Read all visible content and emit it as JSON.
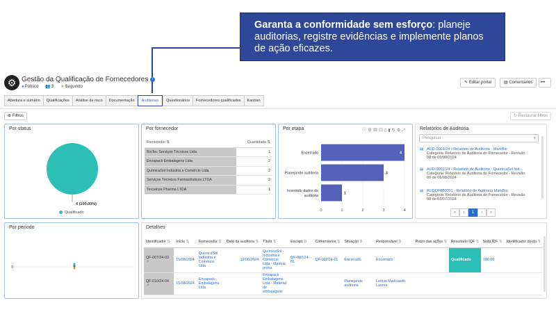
{
  "callout": {
    "bold": "Garanta a conformidade sem esforço",
    "rest": ": planeje auditorias, registre evidências e implemente planos de ação eficazes."
  },
  "header": {
    "title": "Gestão da Qualificação de Fornecedores",
    "visibility": "Público",
    "members": "3",
    "following": "Seguindo"
  },
  "actions": {
    "edit": "Editar portal",
    "comments": "Comentários",
    "more": "•••"
  },
  "tabs": [
    "Abertura e sumário",
    "Qualificações",
    "Análise de risco",
    "Documentação",
    "Auditorias",
    "Questionários",
    "Fornecedores qualificados",
    "Kanban"
  ],
  "filters": {
    "filter_label": "Filtros",
    "restore_label": "Restaurar filtros"
  },
  "status_panel": {
    "title": "Por status",
    "slice_label": "4 (100.00%)",
    "legend": "Qualificado"
  },
  "supplier_panel": {
    "title": "Por fornecedor",
    "col_supplier": "Fornecedor",
    "col_qty": "Quantidade",
    "rows": [
      {
        "name": "BioTec Serviços Técnicos Ltda.",
        "qty": "1"
      },
      {
        "name": "Envapack Embalagens Ltda",
        "qty": "2"
      },
      {
        "name": "QuímicaSol Indústria e Comércio Ltda",
        "qty": "2"
      },
      {
        "name": "Serviços Técnicos Farmacêuticos LTDA",
        "qty": "2"
      },
      {
        "name": "Terceirize Pharma LTDA",
        "qty": "1"
      }
    ]
  },
  "stage_panel": {
    "title": "Por etapa"
  },
  "chart_data": [
    {
      "type": "pie",
      "title": "Por status",
      "categories": [
        "Qualificado"
      ],
      "values": [
        4
      ],
      "labels": [
        "4 (100.00%)"
      ]
    },
    {
      "type": "bar",
      "title": "Por etapa",
      "orientation": "horizontal",
      "categories": [
        "Encerrado",
        "Planejando auditoria",
        "Inserindo dados da auditoria"
      ],
      "values": [
        4,
        3,
        1
      ],
      "data_labels": [
        "4",
        "3",
        "1"
      ],
      "xlim": [
        0,
        4
      ],
      "xticks": [
        "0",
        "1",
        "2",
        "3",
        "4"
      ],
      "color": "#5560b8"
    }
  ],
  "reports_panel": {
    "title": "Relatórios de Auditoria",
    "search_placeholder": "Pesquisar",
    "items": [
      {
        "title": "AUD-0001/24 - Relatório de Auditoria - MarkBio",
        "sub1": "Categoria: Relatório de Auditoria do Fornecedor - Revisão",
        "sub2": "00 de 05/08/2024"
      },
      {
        "title": "AUD-0002/24 - Relatório de Auditoria - QuímicaSol Ind...",
        "sub1": "Categoria: Relatório de Auditoria do Fornecedor - Revisão",
        "sub2": "00 de 06/08/2024"
      },
      {
        "title": "AUDQF000001 - Relatório de Auditoria MarkBio",
        "sub1": "Categoria: Relatório de Auditoria do Fornecedor - Revisão",
        "sub2": "00 de 02/07/2024"
      }
    ],
    "pager": [
      "«",
      "‹",
      "1",
      "›",
      "»"
    ]
  },
  "period_panel": {
    "title": "Por período",
    "axis_zero": "0"
  },
  "details_panel": {
    "title": "Detalhes",
    "columns": [
      "Identificador",
      "Início",
      "Fornecedor",
      "Data da auditoria",
      "Título",
      "Escopo",
      "Comentários",
      "Situação",
      "Responsável",
      "Prazo das ações",
      "Resultado IQF",
      "Nota IQF",
      "Identificador do do"
    ],
    "rows": [
      {
        "id": "QF-007/24-03",
        "inicio": "15/08/2024",
        "fornecedor": "QuímicaSol Indústria e Comércio Ltda",
        "data": "19/08/2024",
        "titulo": "QuímicaSol - Indústria e Comércio Ltda - Matéria prima",
        "escopo": "QF-007/24-01",
        "comentarios": "QF-007/24-01",
        "situacao": "Encerrado",
        "responsavel": "Encerrado",
        "prazo": "",
        "resultado": "Qualificado",
        "nota": "100.00",
        "ident": ""
      },
      {
        "id": "QF-010/24-04",
        "inicio": "15/08/2024",
        "fornecedor": "Envapack Embalagens Ltda",
        "data": "",
        "titulo": "Envapack Embalagens Ltda - Material de embalagem",
        "escopo": "",
        "comentarios": "",
        "situacao": "Planejando auditoria",
        "responsavel": "Letícia Marksaeth Lavera",
        "prazo": "",
        "resultado": "",
        "nota": "",
        "ident": ""
      }
    ]
  }
}
